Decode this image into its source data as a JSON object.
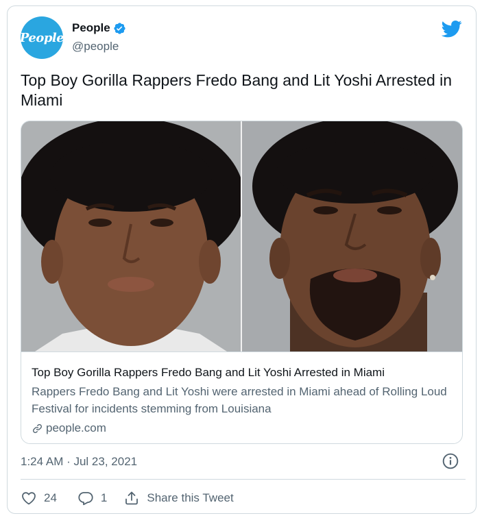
{
  "account": {
    "avatar_text": "People",
    "display_name": "People",
    "handle": "@people",
    "verified": true
  },
  "tweet": {
    "text": "Top Boy Gorilla Rappers Fredo Bang and Lit Yoshi Arrested in Miami"
  },
  "card": {
    "title": "Top Boy Gorilla Rappers Fredo Bang and Lit Yoshi Arrested in Miami",
    "description": "Rappers Fredo Bang and Lit Yoshi were arrested in Miami ahead of Rolling Loud Festival for incidents stemming from Louisiana",
    "domain": "people.com"
  },
  "meta": {
    "timestamp": "1:24 AM · Jul 23, 2021"
  },
  "actions": {
    "like_count": "24",
    "reply_count": "1",
    "share_label": "Share this Tweet"
  },
  "colors": {
    "brand_blue": "#1d9bf0",
    "avatar_blue": "#2aa6e0",
    "text_primary": "#0f1419",
    "text_secondary": "#536471",
    "border": "#cfd9de"
  },
  "icons": [
    "verified-badge-icon",
    "twitter-bird-icon",
    "link-icon",
    "info-icon",
    "heart-icon",
    "reply-icon",
    "share-icon"
  ]
}
